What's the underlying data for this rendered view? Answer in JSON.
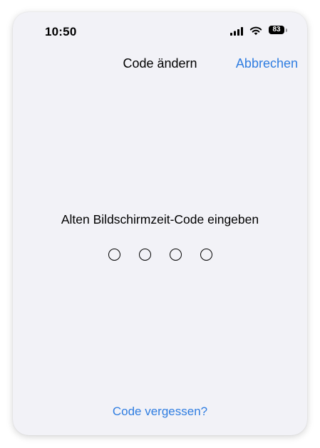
{
  "status_bar": {
    "time": "10:50",
    "battery_level": "83",
    "icons": [
      "cellular-signal-icon",
      "wifi-icon",
      "battery-icon"
    ]
  },
  "nav": {
    "title": "Code ändern",
    "cancel_label": "Abbrechen"
  },
  "passcode": {
    "prompt": "Alten Bildschirmzeit-Code eingeben",
    "digits_total": 4,
    "digits_entered": 0
  },
  "footer": {
    "forgot_label": "Code vergessen?"
  },
  "colors": {
    "accent": "#2f7de1",
    "background": "#f2f2f7"
  }
}
